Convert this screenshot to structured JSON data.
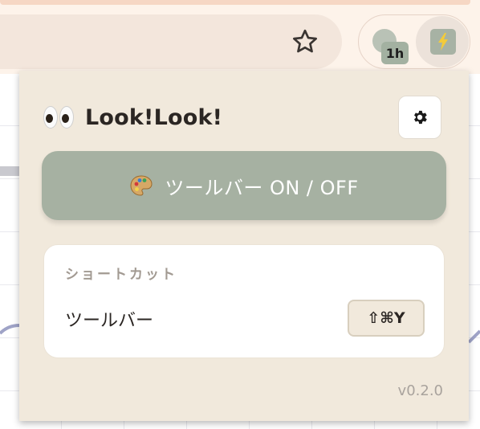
{
  "browser": {
    "extension_badge": "1h",
    "icons": [
      "star-icon",
      "extension-icon",
      "lightning-icon"
    ]
  },
  "popup": {
    "title": "Look!Look!",
    "title_icon": "eyes-icon",
    "settings_icon": "gear-icon",
    "toggle_button": {
      "icon": "palette-icon",
      "label": "ツールバー ON / OFF",
      "color": "#a6b1a2"
    },
    "shortcut": {
      "heading": "ショートカット",
      "label": "ツールバー",
      "key": "⇧⌘Y"
    },
    "version": "v0.2.0",
    "background": "#f1e9dc"
  }
}
